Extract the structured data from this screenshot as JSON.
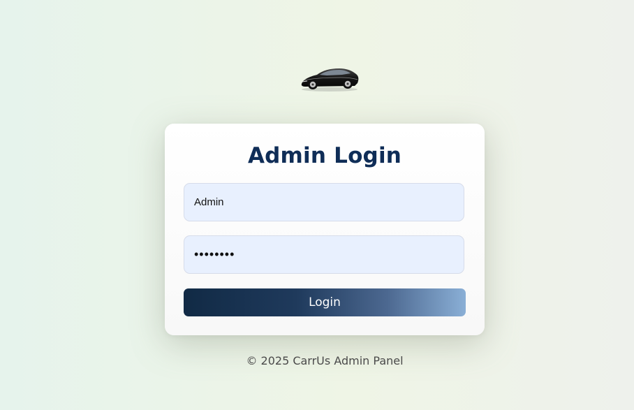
{
  "logo": {
    "icon": "sports-car-icon"
  },
  "login_form": {
    "title": "Admin Login",
    "username_value": "Admin",
    "password_value": "••••••••",
    "submit_label": "Login"
  },
  "footer": {
    "text": "© 2025 CarrUs Admin Panel"
  },
  "colors": {
    "title": "#0f2d57",
    "input_bg": "#e8f0fe",
    "button_start": "#112a45",
    "button_end": "#8aafd6"
  }
}
